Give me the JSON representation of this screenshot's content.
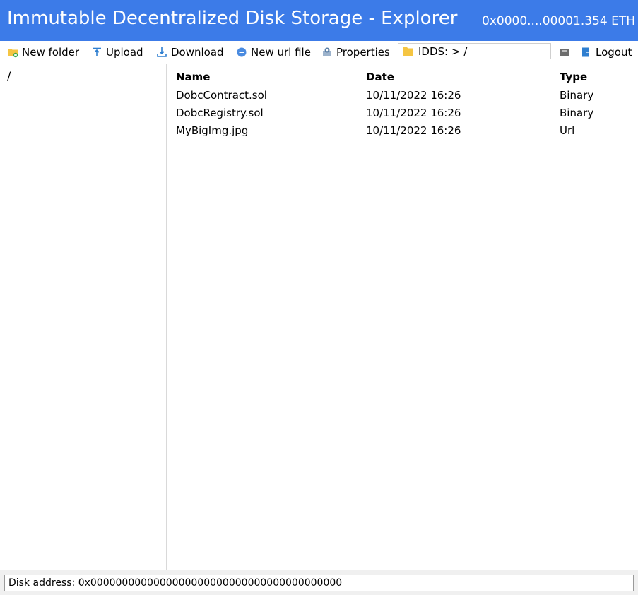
{
  "window": {
    "title": "Immutable Decentralized Disk Storage - Explorer",
    "account": "0x0000....0000",
    "balance": "1.354 ETH"
  },
  "toolbar": {
    "new_folder": "New folder",
    "upload": "Upload",
    "download": "Download",
    "new_url_file": "New url file",
    "properties": "Properties",
    "path": "IDDS: > /",
    "logout": "Logout"
  },
  "tree": {
    "root": "/"
  },
  "files": {
    "headers": {
      "name": "Name",
      "date": "Date",
      "type": "Type"
    },
    "rows": [
      {
        "name": "DobcContract.sol",
        "date": "10/11/2022 16:26",
        "type": "Binary"
      },
      {
        "name": "DobcRegistry.sol",
        "date": "10/11/2022 16:26",
        "type": "Binary"
      },
      {
        "name": "MyBigImg.jpg",
        "date": "10/11/2022 16:26",
        "type": "Url"
      }
    ]
  },
  "status": {
    "disk_address": "Disk address: 0x0000000000000000000000000000000000000000"
  },
  "colors": {
    "title_bar": "#3c7be8",
    "folder": "#f5c542",
    "icon_blue": "#2f7fd0"
  },
  "icons": {
    "new_folder": "new-folder-icon",
    "upload": "upload-icon",
    "download": "download-icon",
    "new_url_file": "url-file-icon",
    "properties": "properties-icon",
    "path": "folder-icon",
    "drive": "drive-icon",
    "logout": "logout-icon"
  }
}
